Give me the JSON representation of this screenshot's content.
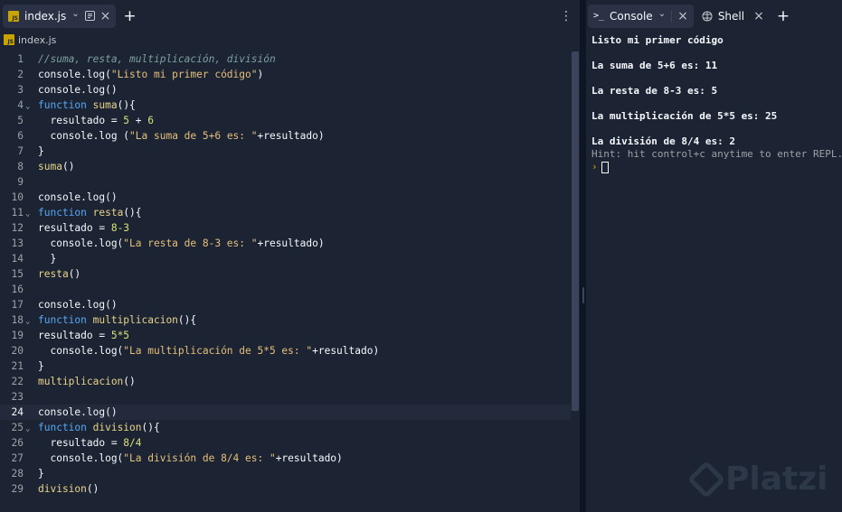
{
  "editor_tab": {
    "badge": "JS",
    "label": "index.js",
    "dropdown": "⌄",
    "close": "×"
  },
  "add_tab": "+",
  "more_menu": "⋮",
  "breadcrumb": {
    "badge": "JS",
    "file": "index.js"
  },
  "current_line": 24,
  "code_lines": [
    {
      "n": "1",
      "fold": "",
      "tokens": [
        {
          "t": "c",
          "v": "//suma, resta, multiplicación, división"
        }
      ]
    },
    {
      "n": "2",
      "fold": "",
      "tokens": [
        {
          "t": "p",
          "v": "console.log("
        },
        {
          "t": "s",
          "v": "\"Listo mi primer código\""
        },
        {
          "t": "p",
          "v": ")"
        }
      ]
    },
    {
      "n": "3",
      "fold": "",
      "tokens": [
        {
          "t": "p",
          "v": "console.log()"
        }
      ]
    },
    {
      "n": "4",
      "fold": "⌄",
      "tokens": [
        {
          "t": "k",
          "v": "function "
        },
        {
          "t": "fn",
          "v": "suma"
        },
        {
          "t": "p",
          "v": "(){"
        }
      ]
    },
    {
      "n": "5",
      "fold": "",
      "tokens": [
        {
          "t": "p",
          "v": "  resultado = "
        },
        {
          "t": "n",
          "v": "5"
        },
        {
          "t": "p",
          "v": " + "
        },
        {
          "t": "n",
          "v": "6"
        }
      ]
    },
    {
      "n": "6",
      "fold": "",
      "tokens": [
        {
          "t": "p",
          "v": "  console.log ("
        },
        {
          "t": "s",
          "v": "\"La suma de 5+6 es: \""
        },
        {
          "t": "p",
          "v": "+resultado)"
        }
      ]
    },
    {
      "n": "7",
      "fold": "",
      "tokens": [
        {
          "t": "p",
          "v": "}"
        }
      ]
    },
    {
      "n": "8",
      "fold": "",
      "tokens": [
        {
          "t": "fn",
          "v": "suma"
        },
        {
          "t": "p",
          "v": "()"
        }
      ]
    },
    {
      "n": "9",
      "fold": "",
      "tokens": []
    },
    {
      "n": "10",
      "fold": "",
      "tokens": [
        {
          "t": "p",
          "v": "console.log()"
        }
      ]
    },
    {
      "n": "11",
      "fold": "⌄",
      "tokens": [
        {
          "t": "k",
          "v": "function "
        },
        {
          "t": "fn",
          "v": "resta"
        },
        {
          "t": "p",
          "v": "(){"
        }
      ]
    },
    {
      "n": "12",
      "fold": "",
      "tokens": [
        {
          "t": "p",
          "v": "resultado = "
        },
        {
          "t": "n",
          "v": "8-3"
        }
      ]
    },
    {
      "n": "13",
      "fold": "",
      "tokens": [
        {
          "t": "p",
          "v": "  console.log("
        },
        {
          "t": "s",
          "v": "\"La resta de 8-3 es: \""
        },
        {
          "t": "p",
          "v": "+resultado)"
        }
      ]
    },
    {
      "n": "14",
      "fold": "",
      "tokens": [
        {
          "t": "p",
          "v": "  }"
        }
      ]
    },
    {
      "n": "15",
      "fold": "",
      "tokens": [
        {
          "t": "fn",
          "v": "resta"
        },
        {
          "t": "p",
          "v": "()"
        }
      ]
    },
    {
      "n": "16",
      "fold": "",
      "tokens": []
    },
    {
      "n": "17",
      "fold": "",
      "tokens": [
        {
          "t": "p",
          "v": "console.log()"
        }
      ]
    },
    {
      "n": "18",
      "fold": "⌄",
      "tokens": [
        {
          "t": "k",
          "v": "function "
        },
        {
          "t": "fn",
          "v": "multiplicacion"
        },
        {
          "t": "p",
          "v": "(){"
        }
      ]
    },
    {
      "n": "19",
      "fold": "",
      "tokens": [
        {
          "t": "p",
          "v": "resultado = "
        },
        {
          "t": "n",
          "v": "5*5"
        }
      ]
    },
    {
      "n": "20",
      "fold": "",
      "tokens": [
        {
          "t": "p",
          "v": "  console.log("
        },
        {
          "t": "s",
          "v": "\"La multiplicación de 5*5 es: \""
        },
        {
          "t": "p",
          "v": "+resultado)"
        }
      ]
    },
    {
      "n": "21",
      "fold": "",
      "tokens": [
        {
          "t": "p",
          "v": "}"
        }
      ]
    },
    {
      "n": "22",
      "fold": "",
      "tokens": [
        {
          "t": "fn",
          "v": "multiplicacion"
        },
        {
          "t": "p",
          "v": "()"
        }
      ]
    },
    {
      "n": "23",
      "fold": "",
      "tokens": []
    },
    {
      "n": "24",
      "fold": "",
      "tokens": [
        {
          "t": "p",
          "v": "console.log()"
        }
      ]
    },
    {
      "n": "25",
      "fold": "⌄",
      "tokens": [
        {
          "t": "k",
          "v": "function "
        },
        {
          "t": "fn",
          "v": "division"
        },
        {
          "t": "p",
          "v": "(){"
        }
      ]
    },
    {
      "n": "26",
      "fold": "",
      "tokens": [
        {
          "t": "p",
          "v": "  resultado = "
        },
        {
          "t": "n",
          "v": "8/4"
        }
      ]
    },
    {
      "n": "27",
      "fold": "",
      "tokens": [
        {
          "t": "p",
          "v": "  console.log("
        },
        {
          "t": "s",
          "v": "\"La división de 8/4 es: \""
        },
        {
          "t": "p",
          "v": "+resultado)"
        }
      ]
    },
    {
      "n": "28",
      "fold": "",
      "tokens": [
        {
          "t": "p",
          "v": "}"
        }
      ]
    },
    {
      "n": "29",
      "fold": "",
      "tokens": [
        {
          "t": "fn",
          "v": "division"
        },
        {
          "t": "p",
          "v": "()"
        }
      ]
    }
  ],
  "console_tab": {
    "icon": ">_",
    "label": "Console",
    "dropdown": "⌄",
    "close": "×"
  },
  "shell_tab": {
    "label": "Shell",
    "close": "×"
  },
  "console_add": "+",
  "console_output": [
    {
      "kind": "out",
      "text": "Listo mi primer código"
    },
    {
      "kind": "blank",
      "text": ""
    },
    {
      "kind": "out",
      "text": "La suma de 5+6 es: 11"
    },
    {
      "kind": "blank",
      "text": ""
    },
    {
      "kind": "out",
      "text": "La resta de 8-3 es: 5"
    },
    {
      "kind": "blank",
      "text": ""
    },
    {
      "kind": "out",
      "text": "La multiplicación de 5*5 es: 25"
    },
    {
      "kind": "blank",
      "text": ""
    },
    {
      "kind": "out",
      "text": "La división de 8/4 es: 2"
    },
    {
      "kind": "hint",
      "text": "Hint: hit control+c anytime to enter REPL."
    }
  ],
  "prompt_symbol": "›",
  "watermark": "Platzi",
  "colors": {
    "keyword": "#56a8f5",
    "string": "#e5c07b",
    "number": "#d8e27a",
    "comment": "#7ca0a0",
    "prompt": "#e5a500"
  }
}
